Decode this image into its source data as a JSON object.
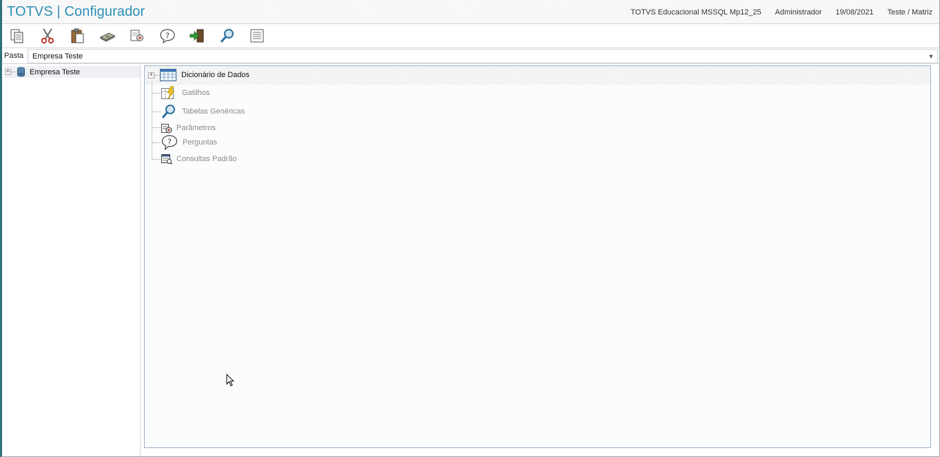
{
  "titlebar": {
    "app": "TOTVS",
    "separator": "|",
    "module": "Configurador",
    "environment": "TOTVS Educacional MSSQL Mp12_25",
    "user": "Administrador",
    "date": "19/08/2021",
    "branch": "Teste / Matriz"
  },
  "toolbar": {
    "buttons": [
      {
        "icon": "copy-icon"
      },
      {
        "icon": "cut-icon"
      },
      {
        "icon": "paste-icon"
      },
      {
        "icon": "money-icon"
      },
      {
        "icon": "settings-doc-icon"
      },
      {
        "icon": "help-icon"
      },
      {
        "icon": "exit-icon"
      },
      {
        "icon": "search-icon"
      },
      {
        "icon": "list-icon"
      }
    ]
  },
  "pasta": {
    "label": "Pasta",
    "selected": "Empresa Teste"
  },
  "left_tree": {
    "items": [
      {
        "label": "Empresa Teste",
        "icon": "database-icon"
      }
    ]
  },
  "right_tree": {
    "root": {
      "label": "Dicionário de Dados",
      "icon": "table-icon"
    },
    "children": [
      {
        "label": "Gatilhos",
        "icon": "trigger-icon"
      },
      {
        "label": "Tabelas Genéricas",
        "icon": "magnifier-icon"
      },
      {
        "label": "Parâmetros",
        "icon": "parameters-icon"
      },
      {
        "label": "Perguntas",
        "icon": "question-icon"
      },
      {
        "label": "Consultas Padrão",
        "icon": "query-icon"
      }
    ]
  },
  "colors": {
    "title": "#2a8fb6",
    "frame": "#2e6f7a",
    "panel_border": "#9bb1c8"
  }
}
